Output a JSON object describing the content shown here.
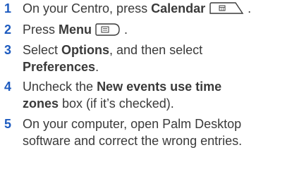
{
  "steps": [
    {
      "number": "1",
      "parts": {
        "a": "On your Centro, press ",
        "b": "Calendar",
        "c": " ."
      },
      "icon": "calendar-key-icon"
    },
    {
      "number": "2",
      "parts": {
        "a": "Press ",
        "b": "Menu",
        "c": " ."
      },
      "icon": "menu-key-icon"
    },
    {
      "number": "3",
      "parts": {
        "a": "Select ",
        "b": "Options",
        "c": ", and then select",
        "d": "Preferences",
        "e": "."
      }
    },
    {
      "number": "4",
      "parts": {
        "a": "Uncheck the ",
        "b": "New events use time",
        "c": "zones",
        "d": " box (if it’s checked)."
      }
    },
    {
      "number": "5",
      "lines": [
        "On your computer, open Palm Desktop",
        "software and correct the wrong entries."
      ]
    }
  ],
  "colors": {
    "step_number": "#1e5bbf",
    "text": "#3a3a3a"
  }
}
